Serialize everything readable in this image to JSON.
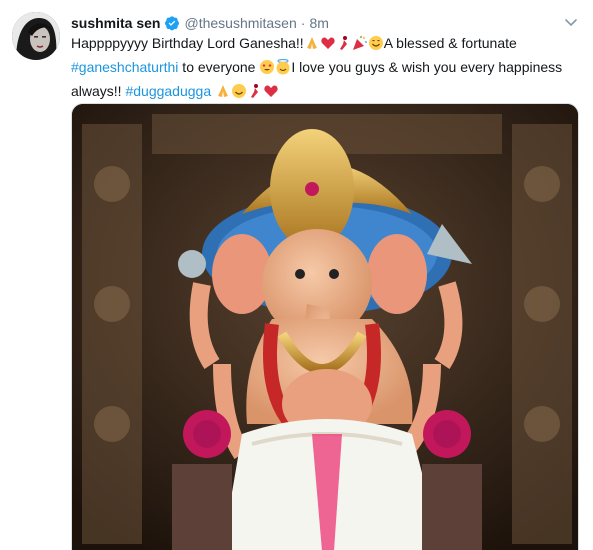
{
  "tweet": {
    "display_name": "sushmita sen",
    "handle": "@thesushmitasen",
    "separator": "·",
    "timestamp": "8m",
    "text": {
      "p1": "Happppyyyy Birthday Lord Ganesha!!",
      "p2": "A blessed & fortunate ",
      "hashtag1": "#ganeshchaturthi",
      "p3": " to everyone ",
      "p4": "I love you guys & wish you every happiness always!! ",
      "hashtag2": "#duggadugga"
    }
  },
  "icons": {
    "verified": "verified-badge-icon",
    "menu": "chevron-down-icon"
  },
  "colors": {
    "hashtag": "#1b95e0",
    "verified": "#1da1f2",
    "secondary_text": "#657786"
  }
}
